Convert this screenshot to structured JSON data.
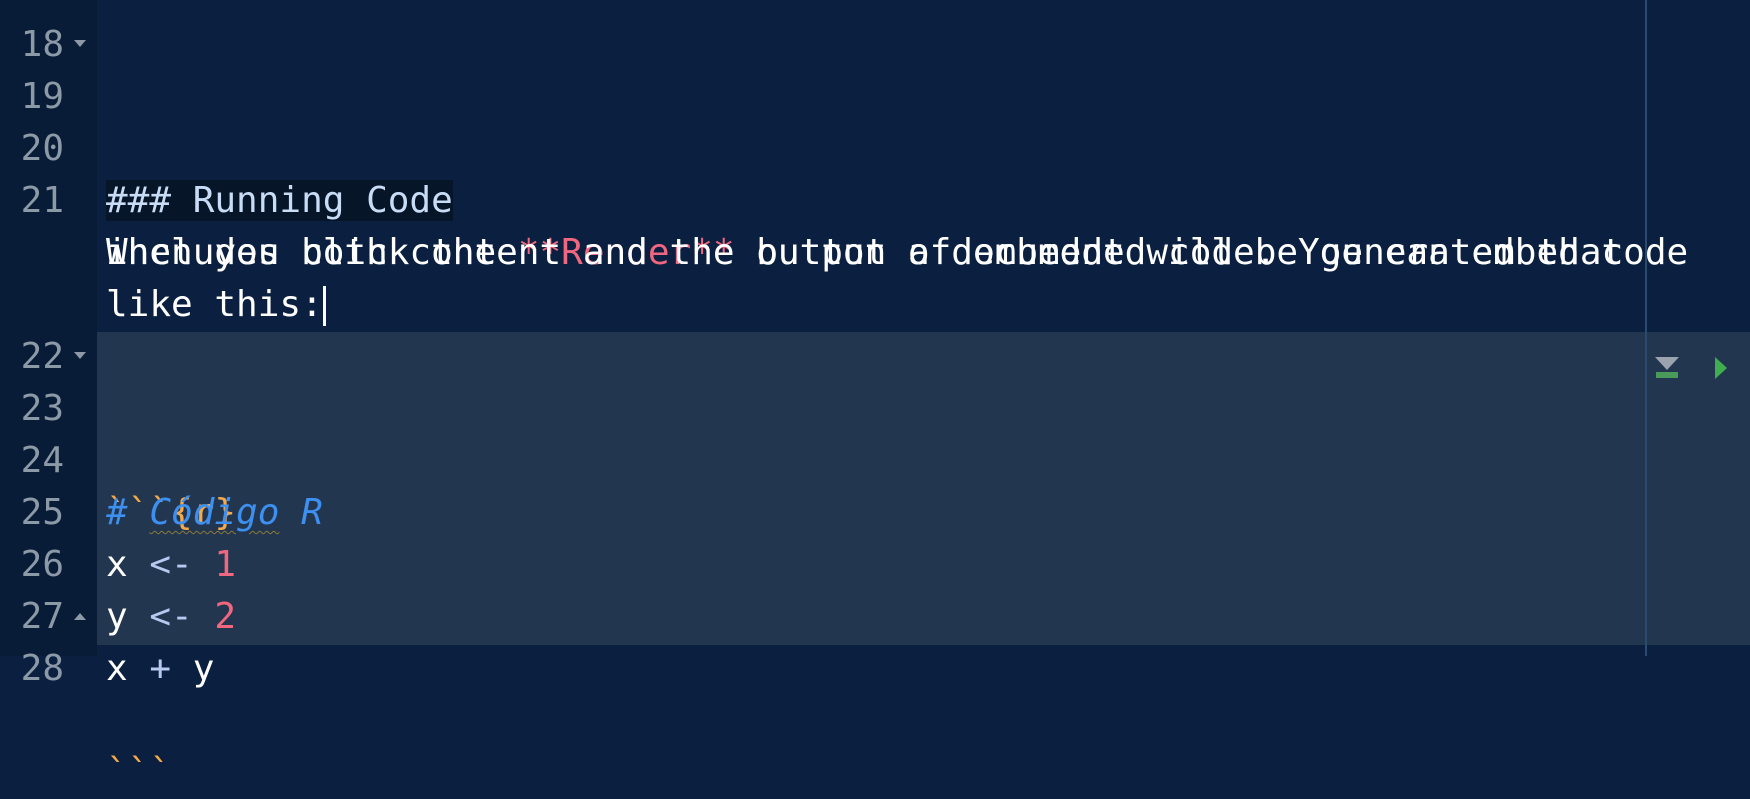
{
  "editor": {
    "lines": [
      {
        "num": "18",
        "text": ""
      },
      {
        "num": "19",
        "header": "### Running Code"
      },
      {
        "num": "20",
        "text": ""
      },
      {
        "num": "21",
        "pre": "When you click the ",
        "bold": "**Render**",
        "post": " button a document will be generated that"
      },
      {
        "cont": "includes both content and the output of embedded code. You can embed code"
      },
      {
        "cont": "like this:"
      },
      {
        "num": "22",
        "text": ""
      },
      {
        "num": "23",
        "fence": "```",
        "engine": "{r}"
      },
      {
        "num": "24",
        "comment_hash": "# ",
        "comment_word": "Código",
        "comment_rest": " R"
      },
      {
        "num": "25",
        "var": "x",
        "op": " <- ",
        "value": "1"
      },
      {
        "num": "26",
        "var": "y",
        "op": " <- ",
        "value": "2"
      },
      {
        "num": "27",
        "var": "x",
        "op": " + ",
        "var2": "y"
      },
      {
        "num": "28",
        "fence": "```"
      }
    ]
  },
  "chunk_toolbar": {
    "icons": [
      "run-all-chunks-above-icon",
      "run-current-chunk-icon"
    ],
    "colors": {
      "run": "#3fae4f"
    }
  }
}
